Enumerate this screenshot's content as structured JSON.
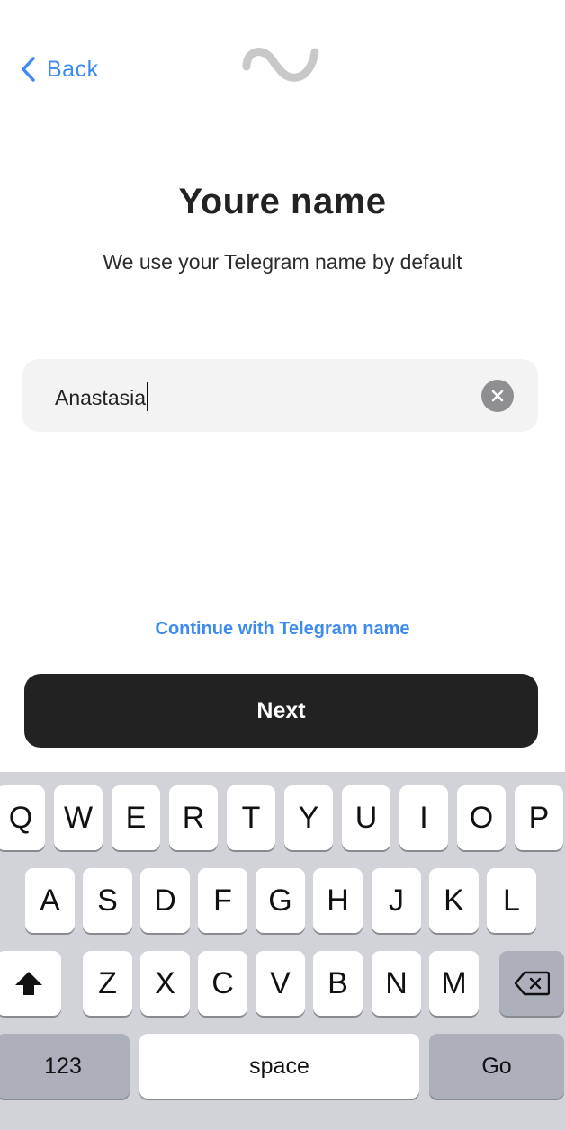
{
  "header": {
    "back_label": "Back",
    "back_icon": "chevron-left-icon",
    "logo_icon": "wave-logo-icon"
  },
  "title": "Youre name",
  "subtitle": "We use your Telegram name by default",
  "name_field": {
    "value": "Anastasia",
    "clear_icon": "clear-icon"
  },
  "continue_link": "Continue with Telegram name",
  "next_button": "Next",
  "colors": {
    "accent": "#3d8af0",
    "button": "#222222",
    "field_bg": "#f3f3f3",
    "keyboard_bg": "#d1d3d9"
  },
  "keyboard": {
    "row1": [
      "Q",
      "W",
      "E",
      "R",
      "T",
      "Y",
      "U",
      "I",
      "O",
      "P"
    ],
    "row2": [
      "A",
      "S",
      "D",
      "F",
      "G",
      "H",
      "J",
      "K",
      "L"
    ],
    "row3": [
      "Z",
      "X",
      "C",
      "V",
      "B",
      "N",
      "M"
    ],
    "shift_icon": "shift-icon",
    "backspace_icon": "backspace-icon",
    "numbers_label": "123",
    "space_label": "space",
    "go_label": "Go"
  }
}
